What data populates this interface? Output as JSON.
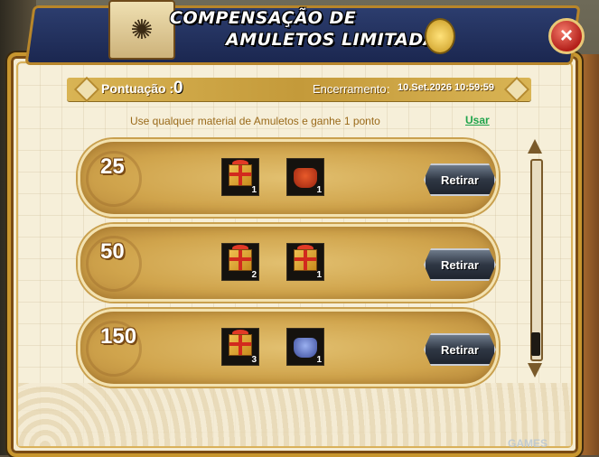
{
  "header": {
    "title_line1": "COMPENSAÇÃO DE",
    "title_line2": "AMULETOS LIMITADA",
    "close_icon": "×"
  },
  "score": {
    "label": "Pontuação :",
    "value": "0",
    "end_label": "Encerramento",
    "end_sep": ":",
    "end_value": "10.Set.2026 10:59:59"
  },
  "hint": "Use qualquer material de Amuletos e ganhe 1 ponto",
  "use_label": "Usar",
  "rows": [
    {
      "points": "25",
      "items": [
        {
          "icon": "gift-box-icon",
          "count": "1"
        },
        {
          "icon": "red-pouch-icon",
          "count": "1"
        }
      ],
      "button": "Retirar"
    },
    {
      "points": "50",
      "items": [
        {
          "icon": "gift-box-icon",
          "count": "2"
        },
        {
          "icon": "gift-box-icon",
          "count": "1"
        }
      ],
      "button": "Retirar"
    },
    {
      "points": "150",
      "items": [
        {
          "icon": "gift-box-icon",
          "count": "3"
        },
        {
          "icon": "blue-pouch-icon",
          "count": "1"
        }
      ],
      "button": "Retirar"
    }
  ],
  "watermark": "GAMES",
  "colors": {
    "accent_gold": "#c8962e",
    "banner_blue": "#1b2750",
    "link_green": "#1ea34a",
    "close_red": "#b3201a"
  }
}
